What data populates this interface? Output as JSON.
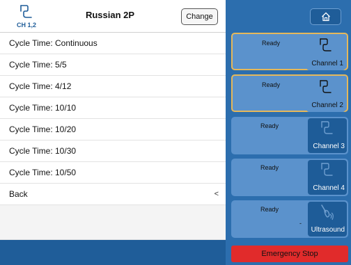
{
  "header": {
    "channel_label": "CH 1,2",
    "title": "Russian 2P",
    "change_label": "Change"
  },
  "menu": {
    "items": [
      {
        "label": "Cycle Time: Continuous"
      },
      {
        "label": "Cycle Time: 5/5"
      },
      {
        "label": "Cycle Time: 4/12"
      },
      {
        "label": "Cycle Time: 10/10"
      },
      {
        "label": "Cycle Time: 10/20"
      },
      {
        "label": "Cycle Time: 10/30"
      },
      {
        "label": "Cycle Time: 10/50"
      },
      {
        "label": "Back",
        "arrow": "<"
      }
    ]
  },
  "channels": [
    {
      "status": "Ready",
      "label": "Channel 1",
      "icon": "electrode-icon",
      "selected": true
    },
    {
      "status": "Ready",
      "label": "Channel 2",
      "icon": "electrode-icon",
      "selected": true
    },
    {
      "status": "Ready",
      "label": "Channel 3",
      "icon": "electrode-icon",
      "selected": false
    },
    {
      "status": "Ready",
      "label": "Channel 4",
      "icon": "electrode-icon",
      "selected": false
    },
    {
      "status": "Ready",
      "value": "-",
      "label": "Ultrasound",
      "icon": "ultrasound-icon",
      "selected": false
    }
  ],
  "emergency_stop_label": "Emergency Stop",
  "icons": {
    "home": "home-icon"
  },
  "colors": {
    "background": "#1f5d99",
    "channel_button": "#5b92cc",
    "selected_border": "#e6b85a",
    "emergency": "#e12b2b"
  }
}
